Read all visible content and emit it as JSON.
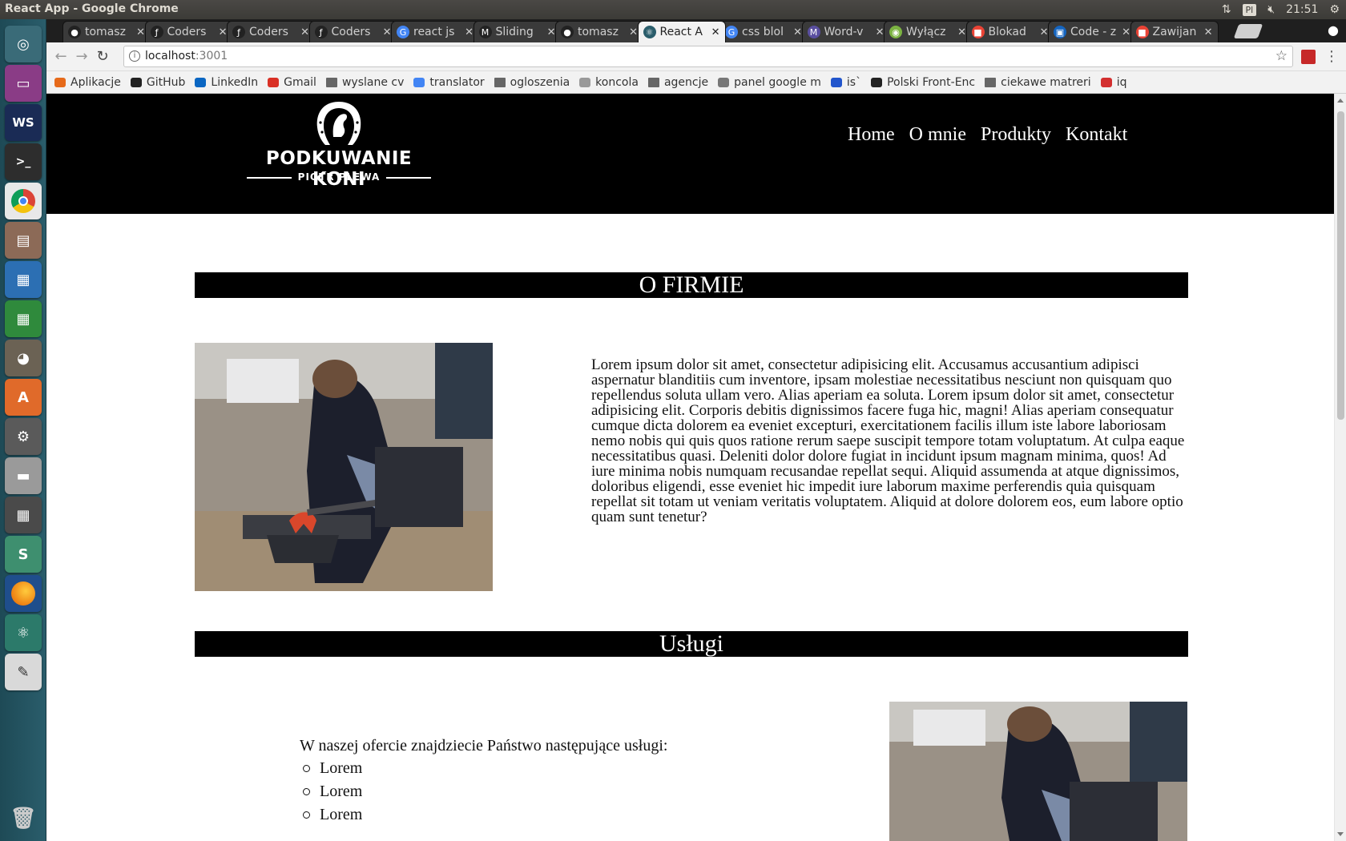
{
  "os": {
    "window_title": "React App - Google Chrome",
    "keyboard_layout": "Pl",
    "clock": "21:51"
  },
  "launcher": {
    "items": [
      "ubuntu-dash",
      "workspace-switcher",
      "webstorm",
      "terminal",
      "chrome",
      "files",
      "writer",
      "calc",
      "gimp",
      "software-center",
      "system-settings",
      "scanner",
      "calculator",
      "slack",
      "firefox",
      "atom",
      "text-editor",
      "trash"
    ]
  },
  "browser": {
    "tabs": [
      {
        "label": "tomasz",
        "icon": "github-icon",
        "color": "#ffffff"
      },
      {
        "label": "Coders",
        "icon": "symfony-icon",
        "color": "#ffffff"
      },
      {
        "label": "Coders",
        "icon": "symfony-icon",
        "color": "#ffffff"
      },
      {
        "label": "Coders",
        "icon": "symfony-icon",
        "color": "#ffffff"
      },
      {
        "label": "react js",
        "icon": "google-icon",
        "color": "#4285f4"
      },
      {
        "label": "Sliding",
        "icon": "medium-icon",
        "color": "#ffffff"
      },
      {
        "label": "tomasz",
        "icon": "github-icon",
        "color": "#ffffff"
      },
      {
        "label": "React A",
        "icon": "react-icon",
        "color": "#2a5d6b"
      },
      {
        "label": "css blol",
        "icon": "google-icon",
        "color": "#4285f4"
      },
      {
        "label": "Word-v",
        "icon": "m-icon",
        "color": "#5a4fa0"
      },
      {
        "label": "Wyłącz",
        "icon": "android-icon",
        "color": "#7cb342"
      },
      {
        "label": "Blokad",
        "icon": "blogger-icon",
        "color": "#ea4335"
      },
      {
        "label": "Code - z",
        "icon": "code-icon",
        "color": "#1565c0"
      },
      {
        "label": "Zawijan",
        "icon": "blogger-icon",
        "color": "#ea4335"
      }
    ],
    "active_tab_index": 7,
    "address": {
      "host": "localhost",
      "port": ":3001"
    },
    "bookmarks": [
      {
        "label": "Aplikacje",
        "icon": "apps-icon"
      },
      {
        "label": "GitHub",
        "icon": "github-icon"
      },
      {
        "label": "LinkedIn",
        "icon": "linkedin-icon"
      },
      {
        "label": "Gmail",
        "icon": "gmail-icon"
      },
      {
        "label": "wyslane cv",
        "icon": "folder-icon"
      },
      {
        "label": "translator",
        "icon": "translate-icon"
      },
      {
        "label": "ogloszenia",
        "icon": "folder-icon"
      },
      {
        "label": "koncola",
        "icon": "page-icon"
      },
      {
        "label": "agencje",
        "icon": "folder-icon"
      },
      {
        "label": "panel google m",
        "icon": "gear-icon"
      },
      {
        "label": "is`",
        "icon": "api-icon"
      },
      {
        "label": "Polski Front-Enc",
        "icon": "hexagon-icon"
      },
      {
        "label": "ciekawe matreri",
        "icon": "folder-icon"
      },
      {
        "label": "iq",
        "icon": "iq-icon"
      }
    ]
  },
  "site": {
    "logo_title": "PODKUWANIE KONI",
    "logo_subtitle": "PIOTR PLEWA",
    "nav": [
      "Home",
      "O mnie",
      "Produkty",
      "Kontakt"
    ],
    "about": {
      "heading": "O FIRMIE",
      "text": "Lorem ipsum dolor sit amet, consectetur adipisicing elit. Accusamus accusantium adipisci aspernatur blanditiis cum inventore, ipsam molestiae necessitatibus nesciunt non quisquam quo repellendus soluta ullam vero. Alias aperiam ea soluta. Lorem ipsum dolor sit amet, consectetur adipisicing elit. Corporis debitis dignissimos facere fuga hic, magni! Alias aperiam consequatur cumque dicta dolorem ea eveniet excepturi, exercitationem facilis illum iste labore laboriosam nemo nobis qui quis quos ratione rerum saepe suscipit tempore totam voluptatum. At culpa eaque necessitatibus quasi. Deleniti dolor dolore fugiat in incidunt ipsum magnam minima, quos! Ad iure minima nobis numquam recusandae repellat sequi. Aliquid assumenda at atque dignissimos, doloribus eligendi, esse eveniet hic impedit iure laborum maxime perferendis quia quisquam repellat sit totam ut veniam veritatis voluptatem. Aliquid at dolore dolorem eos, eum labore optio quam sunt tenetur?"
    },
    "services": {
      "heading": "Usługi",
      "intro": "W naszej ofercie znajdziecie Państwo następujące usługi:",
      "items": [
        "Lorem",
        "Lorem",
        "Lorem"
      ]
    }
  }
}
